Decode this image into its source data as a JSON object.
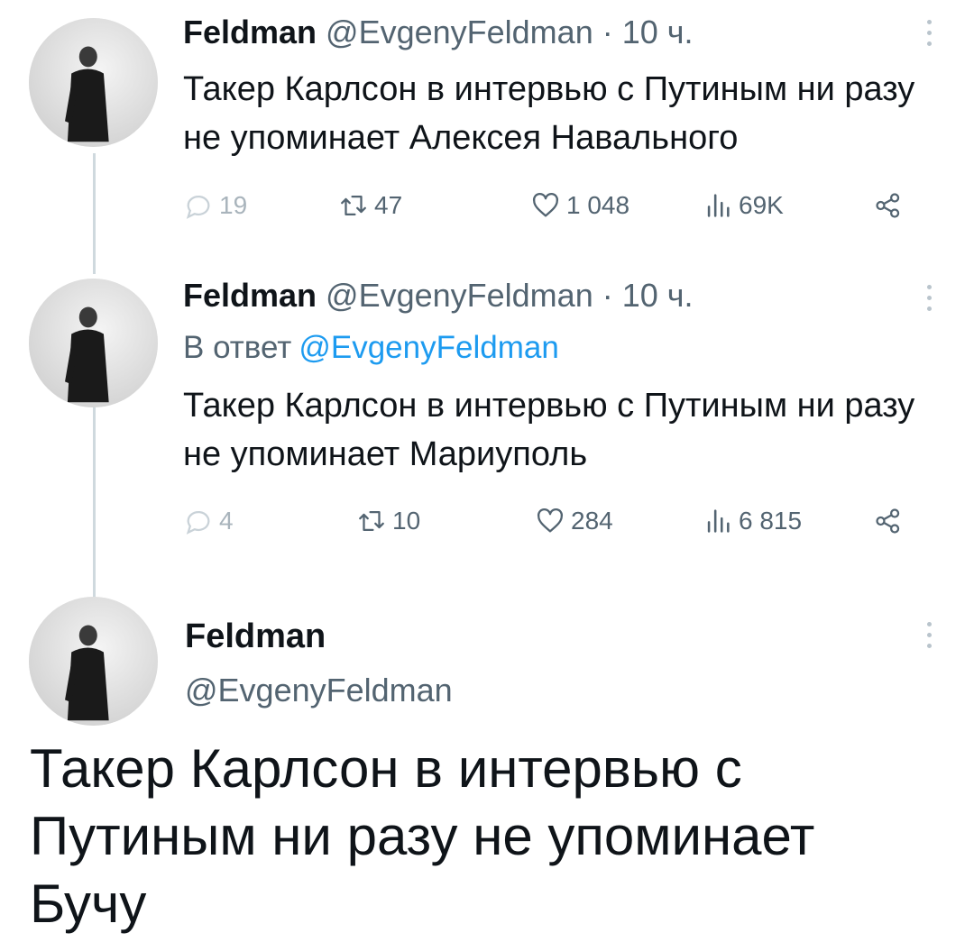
{
  "tweets": [
    {
      "name": "Feldman",
      "handle": "@EvgenyFeldman",
      "time": "· 10 ч.",
      "text": "Такер Карлсон в интервью с Путиным ни разу не упоминает Алексея Навального",
      "replies": "19",
      "retweets": "47",
      "likes": "1 048",
      "views": "69K"
    },
    {
      "name": "Feldman",
      "handle": "@EvgenyFeldman",
      "time": "· 10 ч.",
      "reply_prefix": "В ответ",
      "reply_mention": "@EvgenyFeldman",
      "text": "Такер Карлсон в интервью с Путиным ни разу не упоминает Мариуполь",
      "replies": "4",
      "retweets": "10",
      "likes": "284",
      "views": "6 815"
    }
  ],
  "main_tweet": {
    "name": "Feldman",
    "handle": "@EvgenyFeldman",
    "text": "Такер Карлсон в интервью с Путиным ни разу не упоминает Бучу"
  },
  "icons": {
    "reply": "reply-icon",
    "retweet": "retweet-icon",
    "like": "heart-icon",
    "views": "views-icon",
    "share": "share-icon",
    "more": "more-icon"
  },
  "colors": {
    "text": "#0f1419",
    "secondary": "#536471",
    "link": "#1d9bf0",
    "thread_line": "#cfd9de"
  }
}
